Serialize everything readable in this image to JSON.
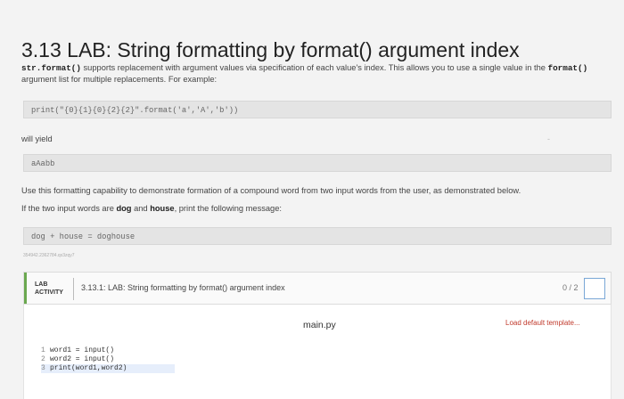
{
  "title": "3.13 LAB: String formatting by format() argument index",
  "intro": {
    "code1": "str.format()",
    "text1": " supports replacement with argument values via specification of each value's index. This allows you to use a single value in the ",
    "code2": "format()",
    "text2": " argument list for multiple replacements. For example:"
  },
  "example_code": "print(\"{0}{1}{0}{2}{2}\".format('a','A','b'))",
  "will_yield": "will yield",
  "example_output": "aAabb",
  "task_text": "Use this formatting capability to demonstrate formation of a compound word from two input words from the user, as demonstrated below.",
  "condition": {
    "pre": "If the two input words are ",
    "w1": "dog",
    "mid": " and ",
    "w2": "house",
    "post": ", print the following message:"
  },
  "expected_output": "dog + house = doghouse",
  "reference_id": "354942.2362784.qx3zqy7",
  "lab": {
    "tag": "LAB ACTIVITY",
    "title": "3.13.1: LAB: String formatting by format() argument index",
    "score": "0 / 2",
    "filename": "main.py",
    "load_template": "Load default template..."
  },
  "code_lines": [
    {
      "num": "1",
      "text": "word1 = input()"
    },
    {
      "num": "2",
      "text": "word2 = input()"
    },
    {
      "num": "3",
      "text": "print(word1,word2)"
    }
  ],
  "colors": {
    "accent_green": "#6aa84f",
    "load_template_red": "#c0392b",
    "score_box_blue": "#7aa7d6"
  }
}
